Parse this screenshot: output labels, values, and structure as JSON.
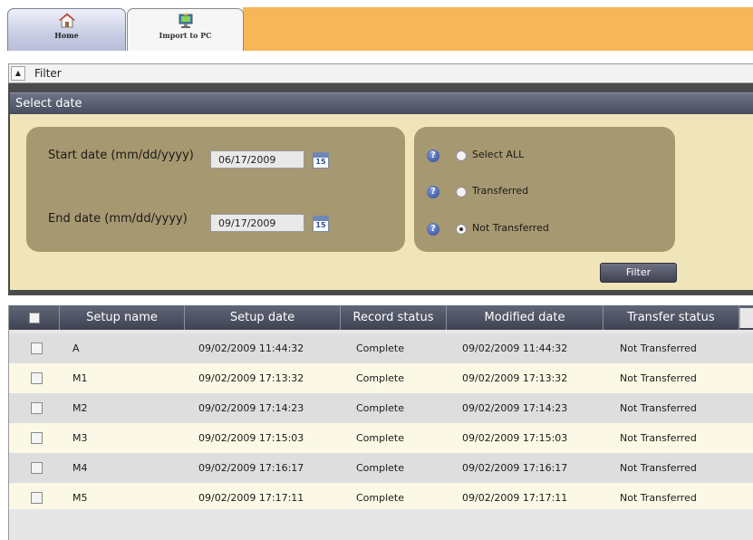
{
  "toolbar": {
    "tabs": [
      {
        "label": "Home",
        "icon": "home-icon",
        "active": true
      },
      {
        "label": "Import to PC",
        "icon": "import-to-pc-icon",
        "active": false
      }
    ],
    "accent_color": "#f7b657"
  },
  "filter": {
    "header_title": "Filter",
    "section_title": "Select date",
    "start_date_label": "Start date (mm/dd/yyyy)",
    "start_date_value": "06/17/2009",
    "end_date_label": "End date (mm/dd/yyyy)",
    "end_date_value": "09/17/2009",
    "calendar_icon_text": "15",
    "radio_options": [
      {
        "label": "Select ALL",
        "checked": false
      },
      {
        "label": "Transferred",
        "checked": false
      },
      {
        "label": "Not Transferred",
        "checked": true
      }
    ],
    "help_icon_text": "?",
    "filter_button_label": "Filter"
  },
  "table": {
    "columns": [
      "Setup name",
      "Setup date",
      "Record status",
      "Modified date",
      "Transfer status"
    ],
    "rows": [
      {
        "name": "A",
        "setup_date": "09/02/2009 11:44:32",
        "record_status": "Complete",
        "modified_date": "09/02/2009 11:44:32",
        "transfer_status": "Not Transferred"
      },
      {
        "name": "M1",
        "setup_date": "09/02/2009 17:13:32",
        "record_status": "Complete",
        "modified_date": "09/02/2009 17:13:32",
        "transfer_status": "Not Transferred"
      },
      {
        "name": "M2",
        "setup_date": "09/02/2009 17:14:23",
        "record_status": "Complete",
        "modified_date": "09/02/2009 17:14:23",
        "transfer_status": "Not Transferred"
      },
      {
        "name": "M3",
        "setup_date": "09/02/2009 17:15:03",
        "record_status": "Complete",
        "modified_date": "09/02/2009 17:15:03",
        "transfer_status": "Not Transferred"
      },
      {
        "name": "M4",
        "setup_date": "09/02/2009 17:16:17",
        "record_status": "Complete",
        "modified_date": "09/02/2009 17:16:17",
        "transfer_status": "Not Transferred"
      },
      {
        "name": "M5",
        "setup_date": "09/02/2009 17:17:11",
        "record_status": "Complete",
        "modified_date": "09/02/2009 17:17:11",
        "transfer_status": "Not Transferred"
      }
    ]
  }
}
